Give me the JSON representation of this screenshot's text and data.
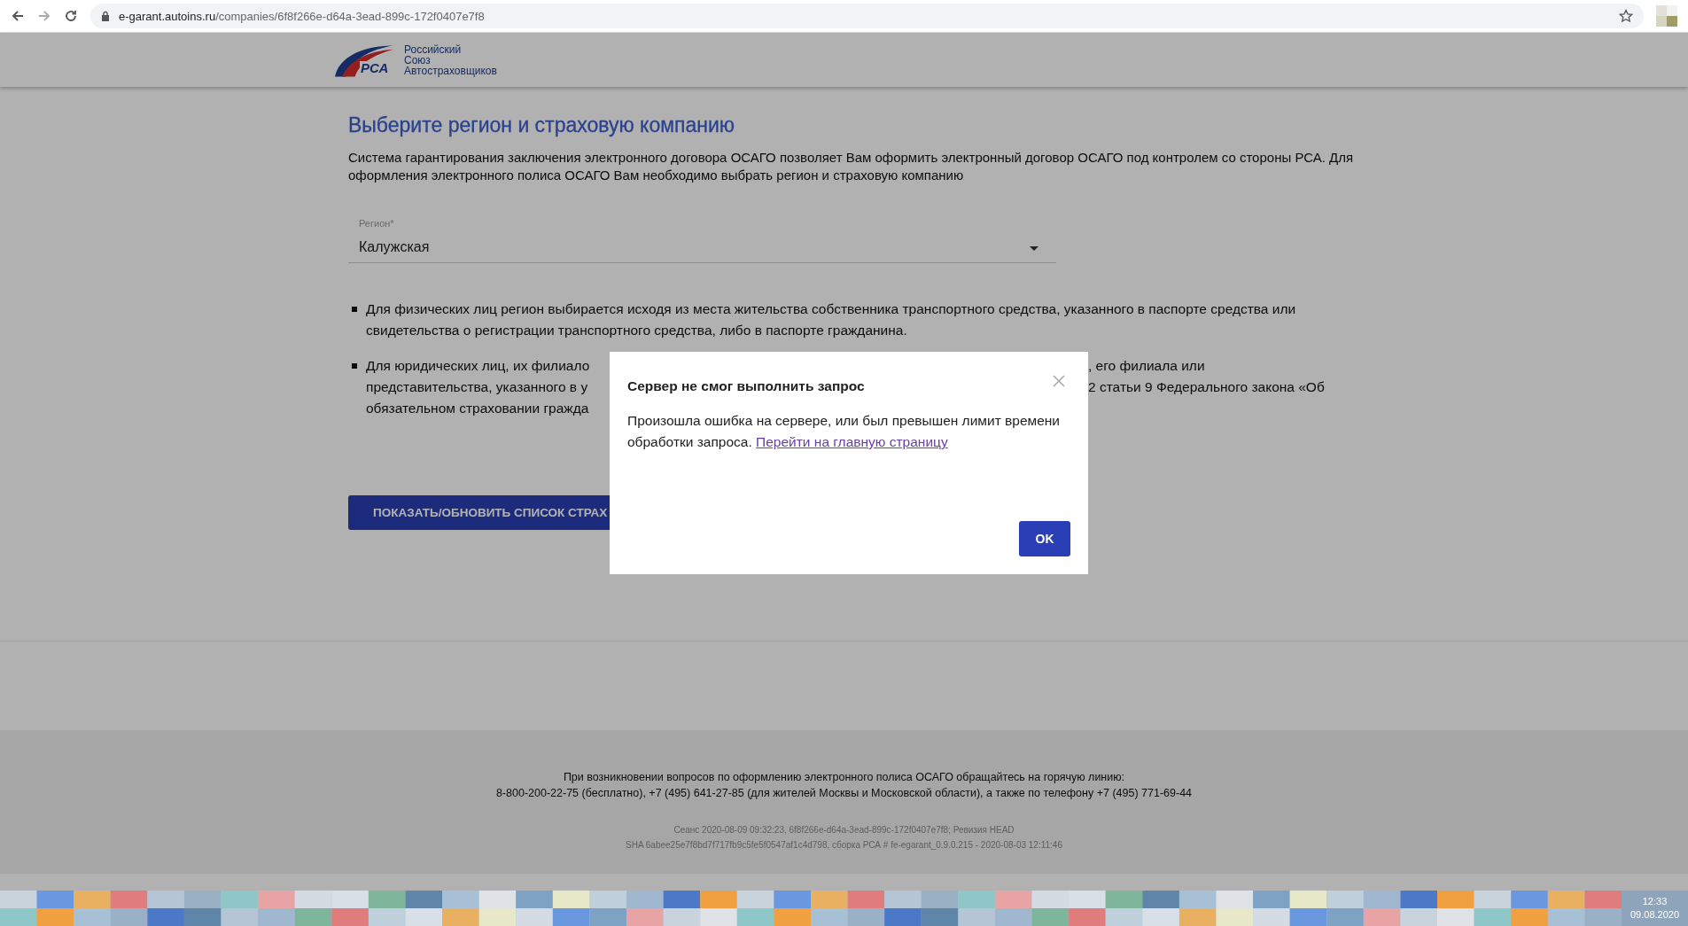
{
  "browser": {
    "url_host": "e-garant.autoins.ru",
    "url_path": "/companies/6f8f266e-d64a-3ead-899c-172f0407e7f8"
  },
  "header": {
    "logo_mark": "РСА",
    "logo_lines": [
      "Российский",
      "Союз",
      "Автостраховщиков"
    ]
  },
  "page": {
    "title": "Выберите регион и страховую компанию",
    "intro": "Система гарантирования заключения электронного договора ОСАГО позволяет Вам оформить электронный договор ОСАГО под контролем со стороны РСА. Для оформления электронного полиса ОСАГО Вам необходимо выбрать регион и страховую компанию",
    "region_field": {
      "label": "Регион*",
      "value": "Калужская"
    },
    "notes": [
      {
        "kind": "full",
        "text": "Для физических лиц регион выбирается исходя из места жительства собственника транспортного средства, указанного в паспорте средства или свидетельства о регистрации транспортного средства, либо в паспорте гражданина."
      },
      {
        "kind": "covered",
        "lines": [
          {
            "left": "Для юридических лиц, их филиало",
            "right": ", его филиала или"
          },
          {
            "left": "представительства, указанного в у",
            "right": "2 статьи 9 Федерального закона «Об"
          },
          {
            "left": "обязательном страховании гражда"
          }
        ]
      }
    ],
    "action_button": "ПОКАЗАТЬ/ОБНОВИТЬ СПИСОК СТРАХ"
  },
  "footer": {
    "hotline": [
      "При возникновении вопросов по оформлению электронного полиса ОСАГО обращайтесь на горячую линию:",
      "8-800-200-22-75 (бесплатно), +7 (495) 641-27-85 (для жителей Москвы и Московской области), а также по телефону +7 (495) 771-69-44"
    ],
    "build_info": [
      "Сеанс 2020-08-09 09:32:23, 6f8f266e-d64a-3ead-899c-172f0407e7f8; Ревизия HEAD",
      "SHA 6abee25e7f8bd7f717fb9c5fe5f0547af1c4d798, сборка РСА # fe-egarant_0.9.0.215 - 2020-08-03 12:11:46"
    ]
  },
  "dialog": {
    "title": "Сервер не смог выполнить запрос",
    "message": "Произошла ошибка на сервере, или был превышен лимит времени обработки запроса.",
    "link": "Перейти на главную страницу",
    "ok_button": "OK"
  },
  "taskbar": {
    "time": "12:33",
    "date": "09.08.2020"
  }
}
